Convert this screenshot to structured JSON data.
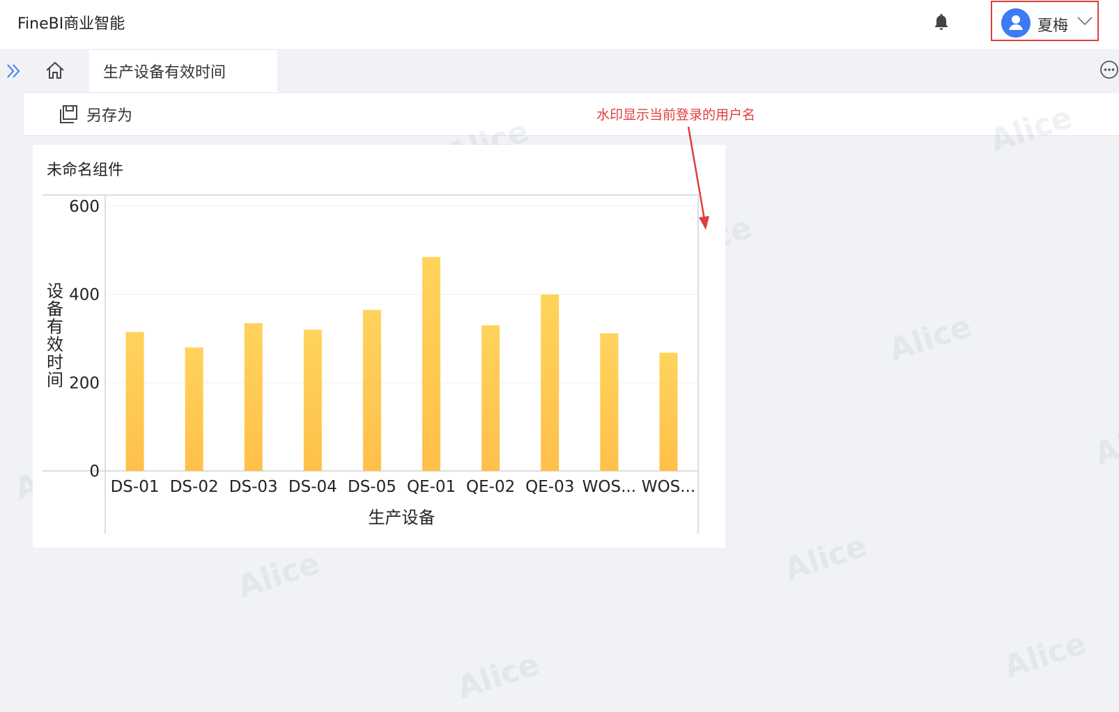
{
  "app": {
    "title": "FineBI商业智能"
  },
  "user": {
    "name": "夏梅"
  },
  "tabs": {
    "active": "生产设备有效时间"
  },
  "toolbar": {
    "save_as": "另存为"
  },
  "annotation": {
    "text": "水印显示当前登录的用户名"
  },
  "watermark": {
    "text": "Alice"
  },
  "widget": {
    "title": "未命名组件"
  },
  "colors": {
    "bar": "#ffc84d",
    "accent": "#3d7bf5",
    "annotation": "#e03c3c"
  },
  "chart_data": {
    "type": "bar",
    "categories": [
      "DS-01",
      "DS-02",
      "DS-03",
      "DS-04",
      "DS-05",
      "QE-01",
      "QE-02",
      "QE-03",
      "WOS...",
      "WOS..."
    ],
    "values": [
      315,
      280,
      335,
      320,
      365,
      485,
      330,
      400,
      312,
      268
    ],
    "xlabel": "生产设备",
    "ylabel": "设备有效时间",
    "yticks": [
      0,
      200,
      400,
      600
    ],
    "ylim": [
      0,
      600
    ],
    "grid": true
  }
}
